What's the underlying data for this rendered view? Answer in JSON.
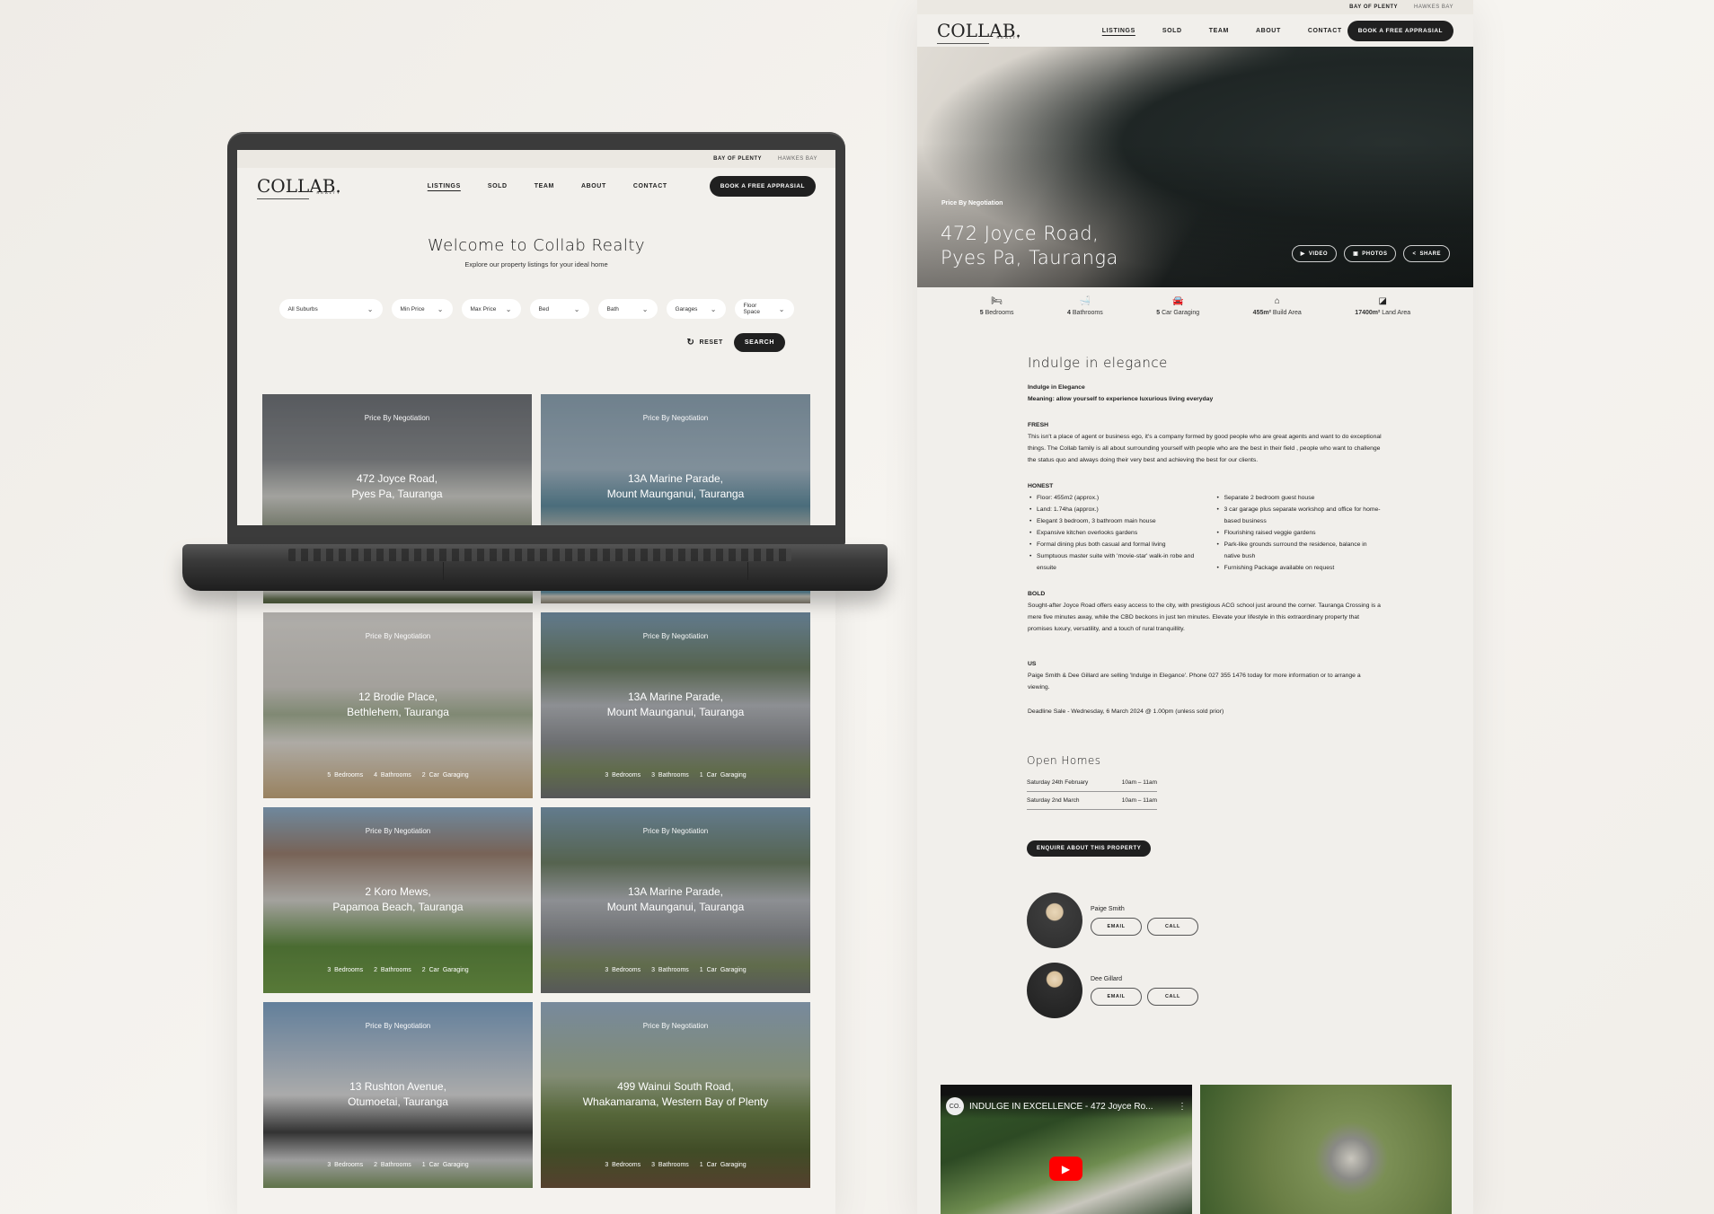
{
  "site": {
    "logo": "COLLAB.",
    "logo_sub": "REALTY",
    "regions": [
      "BAY OF PLENTY",
      "HAWKES BAY"
    ],
    "nav": [
      "LISTINGS",
      "SOLD",
      "TEAM",
      "ABOUT",
      "CONTACT"
    ],
    "cta": "BOOK A FREE APPRASIAL"
  },
  "listings_page": {
    "title": "Welcome to Collab Realty",
    "subtitle": "Explore our property listings for your ideal home",
    "filters": [
      "All Suburbs",
      "Min Price",
      "Max Price",
      "Bed",
      "Bath",
      "Garages",
      "Floor Space"
    ],
    "reset_label": "RESET",
    "search_label": "SEARCH",
    "cards": [
      {
        "price": "Price By Negotiation",
        "line1": "472 Joyce Road,",
        "line2": "Pyes Pa, Tauranga",
        "features": []
      },
      {
        "price": "Price By Negotiation",
        "line1": "13A Marine Parade,",
        "line2": "Mount Maunganui, Tauranga",
        "features": []
      },
      {
        "price": "Price By Negotiation",
        "line1": "12 Brodie Place,",
        "line2": "Bethlehem, Tauranga",
        "features": [
          "5 Bedrooms",
          "4 Bathrooms",
          "2 Car Garaging"
        ]
      },
      {
        "price": "Price By Negotiation",
        "line1": "13A Marine Parade,",
        "line2": "Mount Maunganui, Tauranga",
        "features": [
          "3 Bedrooms",
          "3 Bathrooms",
          "1 Car Garaging"
        ]
      },
      {
        "price": "Price By Negotiation",
        "line1": "2 Koro Mews,",
        "line2": "Papamoa Beach, Tauranga",
        "features": [
          "3 Bedrooms",
          "2 Bathrooms",
          "2 Car Garaging"
        ]
      },
      {
        "price": "Price By Negotiation",
        "line1": "13A Marine Parade,",
        "line2": "Mount Maunganui, Tauranga",
        "features": [
          "3 Bedrooms",
          "3 Bathrooms",
          "1 Car Garaging"
        ]
      },
      {
        "price": "Price By Negotiation",
        "line1": "13 Rushton Avenue,",
        "line2": "Otumoetai, Tauranga",
        "features": [
          "3 Bedrooms",
          "2 Bathrooms",
          "1 Car Garaging"
        ]
      },
      {
        "price": "Price By Negotiation",
        "line1": "499 Wainui South Road,",
        "line2": "Whakamarama, Western Bay of Plenty",
        "features": [
          "3 Bedrooms",
          "3 Bathrooms",
          "1 Car Garaging"
        ]
      }
    ]
  },
  "detail_page": {
    "price": "Price By Negotiation",
    "address_line1": "472 Joyce Road,",
    "address_line2": "Pyes Pa, Tauranga",
    "hero_buttons": [
      {
        "icon": "play-icon",
        "label": "VIDEO"
      },
      {
        "icon": "photos-icon",
        "label": "PHOTOS"
      },
      {
        "icon": "share-icon",
        "label": "SHARE"
      }
    ],
    "stats": [
      {
        "icon": "bed-icon",
        "value": "5",
        "label": "Bedrooms"
      },
      {
        "icon": "bath-icon",
        "value": "4",
        "label": "Bathrooms"
      },
      {
        "icon": "car-icon",
        "value": "5",
        "label": "Car Garaging"
      },
      {
        "icon": "house-icon",
        "value": "455m²",
        "label": "Build Area"
      },
      {
        "icon": "land-icon",
        "value": "17400m²",
        "label": "Land Area"
      }
    ],
    "heading": "Indulge in elegance",
    "intro_title": "Indulge in Elegance",
    "intro_meaning": "Meaning: allow yourself to experience luxurious living everyday",
    "fresh_label": "FRESH",
    "fresh_text": "This isn't a place of agent or business ego, it's a company formed by good people who are great agents and want to do exceptional things. The Collab family is all about surrounding yourself with people who are the best in their field , people who want to challenge the status quo and  always doing their very best and achieving the best for our clients.",
    "honest_label": "HONEST",
    "honest_left": [
      "Floor: 455m2 (approx.)",
      "Land: 1.74ha (approx.)",
      "Elegant 3 bedroom, 3 bathroom main house",
      "Expansive kitchen overlooks gardens",
      "Formal dining plus both casual and formal living",
      "Sumptuous master suite with 'movie-star' walk-in robe and ensuite"
    ],
    "honest_right": [
      "Separate 2 bedroom guest house",
      "3 car garage plus separate workshop and office for home-based business",
      "Flourishing raised veggie gardens",
      "Park-like grounds surround the residence, balance in native bush",
      "Furnishing Package available on request"
    ],
    "bold_label": "BOLD",
    "bold_text": "Sought-after Joyce Road offers easy access to the city, with prestigious ACG school just around the corner. Tauranga Crossing is a mere five minutes away, while the CBD beckons in just ten minutes. Elevate your lifestyle in this extraordinary property that promises luxury, versatility, and a touch of rural tranquillity.",
    "us_label": "US",
    "us_text": "Paige Smith & Dee Gillard are selling 'Indulge in Elegance'. Phone 027 355 1476 today for more information or to arrange a viewing.",
    "deadline": "Deadline Sale - Wednesday, 6 March 2024 @ 1.00pm (unless sold prior)",
    "open_homes_title": "Open Homes",
    "open_homes": [
      {
        "date": "Saturday 24th February",
        "time": "10am – 11am"
      },
      {
        "date": "Saturday 2nd March",
        "time": "10am – 11am"
      }
    ],
    "enquire_label": "ENQUIRE ABOUT THIS PROPERTY",
    "agents": [
      {
        "name": "Paige Smith",
        "email_label": "EMAIL",
        "call_label": "CALL"
      },
      {
        "name": "Dee Gillard",
        "email_label": "EMAIL",
        "call_label": "CALL"
      }
    ],
    "video": {
      "channel": "CO.",
      "title": "INDULGE IN EXCELLENCE - 472 Joyce Ro..."
    }
  }
}
